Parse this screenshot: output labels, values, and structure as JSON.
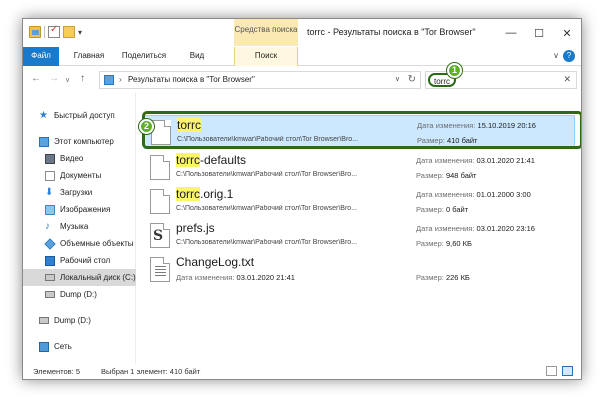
{
  "window": {
    "title": "torrc - Результаты поиска в \"Tor Browser\"",
    "context_group": "Средства поиска",
    "minimize": "—",
    "maximize": "☐",
    "close": "✕"
  },
  "ribbon": {
    "tabs": [
      "Файл",
      "Главная",
      "Поделиться",
      "Вид",
      "Поиск"
    ],
    "expand": "∨",
    "help": "?"
  },
  "address": {
    "back": "←",
    "forward": "→",
    "history": "∨",
    "up": "↑",
    "separator": "›",
    "path": "Результаты поиска в \"Tor Browser\"",
    "dropdown": "∨",
    "refresh": "↻"
  },
  "search": {
    "query": "torrc",
    "clear": "✕"
  },
  "sidebar": {
    "items": [
      {
        "label": "Быстрый доступ",
        "icon": "star-icon"
      },
      {
        "label": "Этот компьютер",
        "icon": "computer-icon"
      },
      {
        "label": "Видео",
        "icon": "video-icon"
      },
      {
        "label": "Документы",
        "icon": "documents-icon"
      },
      {
        "label": "Загрузки",
        "icon": "downloads-icon"
      },
      {
        "label": "Изображения",
        "icon": "pictures-icon"
      },
      {
        "label": "Музыка",
        "icon": "music-icon"
      },
      {
        "label": "Объемные объекты",
        "icon": "3d-objects-icon"
      },
      {
        "label": "Рабочий стол",
        "icon": "desktop-icon"
      },
      {
        "label": "Локальный диск (C:)",
        "icon": "drive-icon"
      },
      {
        "label": "Dump (D:)",
        "icon": "drive-icon"
      },
      {
        "label": "Dump (D:)",
        "icon": "drive-icon"
      },
      {
        "label": "Сеть",
        "icon": "network-icon"
      }
    ]
  },
  "files": [
    {
      "hit": "torrc",
      "rest": "",
      "path": "C:\\Пользователи\\kmwar\\Рабочий стол\\Tor Browser\\Bro...",
      "date_label": "Дата изменения:",
      "date": "15.10.2019 20:16",
      "size_label": "Размер:",
      "size": "410 байт",
      "icon": "file-icon"
    },
    {
      "hit": "torrc",
      "rest": "-defaults",
      "path": "C:\\Пользователи\\kmwar\\Рабочий стол\\Tor Browser\\Bro...",
      "date_label": "Дата изменения:",
      "date": "03.01.2020 21:41",
      "size_label": "Размер:",
      "size": "948 байт",
      "icon": "file-icon"
    },
    {
      "hit": "torrc",
      "rest": ".orig.1",
      "path": "C:\\Пользователи\\kmwar\\Рабочий стол\\Tor Browser\\Bro...",
      "date_label": "Дата изменения:",
      "date": "01.01.2000 3:00",
      "size_label": "Размер:",
      "size": "0 байт",
      "icon": "file-icon"
    },
    {
      "hit": "",
      "rest": "prefs.js",
      "path": "C:\\Пользователи\\kmwar\\Рабочий стол\\Tor Browser\\Bro...",
      "date_label": "Дата изменения:",
      "date": "03.01.2020 23:16",
      "size_label": "Размер:",
      "size": "9,60 КБ",
      "icon": "js-file-icon"
    },
    {
      "hit": "",
      "rest": "ChangeLog.txt",
      "date_label": "Дата изменения:",
      "date": "03.01.2020 21:41",
      "size_label": "Размер:",
      "size": "226 КБ",
      "icon": "text-file-icon"
    }
  ],
  "callouts": {
    "one": "1",
    "two": "2"
  },
  "status": {
    "count": "Элементов: 5",
    "selection": "Выбран 1 элемент: 410 байт"
  },
  "colors": {
    "accent": "#1979ca",
    "selection": "#cce8ff",
    "callout": "#5fae2c",
    "callout_border": "#2e6b17",
    "hit_highlight": "#fbf56b"
  }
}
